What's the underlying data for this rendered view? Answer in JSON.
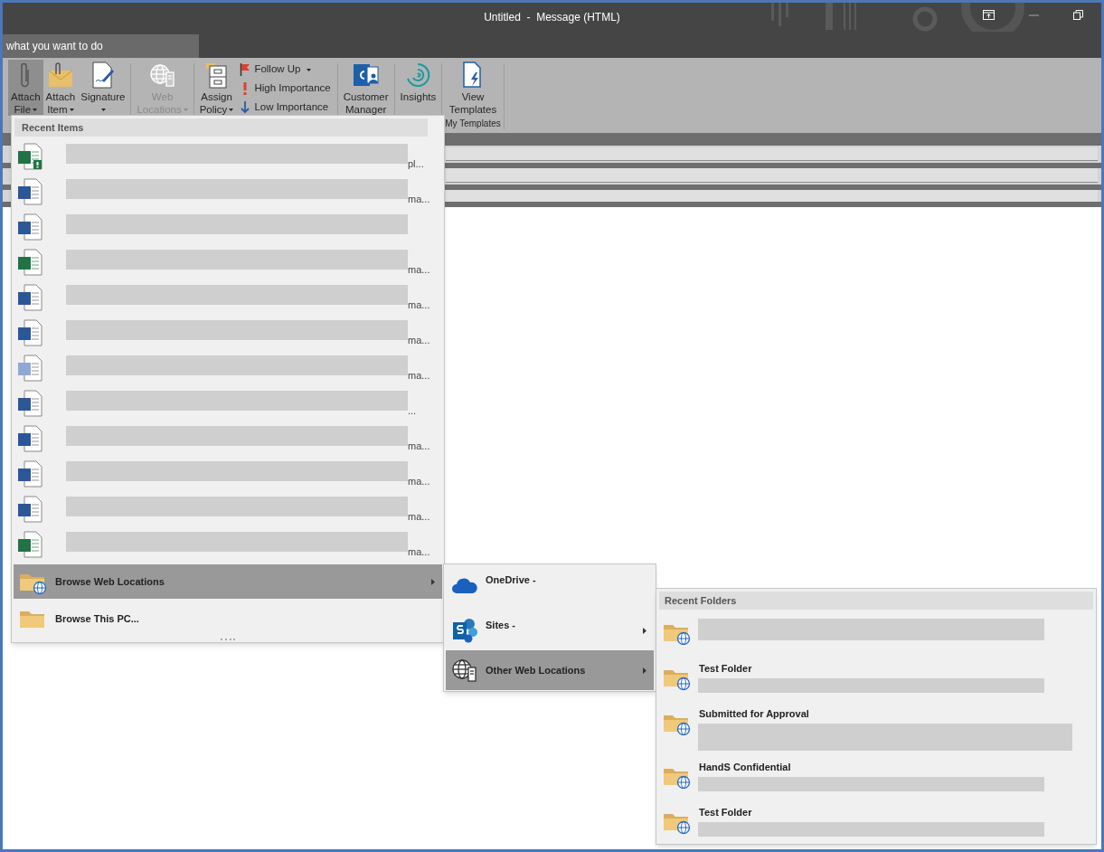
{
  "window": {
    "title": "Untitled  -  Message (HTML)"
  },
  "tell_me": {
    "text": "what you want to do"
  },
  "ribbon": [
    {
      "kind": "paperclip",
      "line1": "Attach",
      "line2": "File",
      "dropdown": true,
      "selected": true,
      "disabled": false
    },
    {
      "kind": "envelope-clip",
      "line1": "Attach",
      "line2": "Item",
      "dropdown": true,
      "selected": false,
      "disabled": false
    },
    {
      "kind": "signature",
      "line1": "Signature",
      "dropdown": true,
      "selected": false,
      "disabled": false
    },
    {
      "kind": "separator"
    },
    {
      "kind": "globe-server",
      "line1": "Web",
      "line2": "Locations",
      "dropdown": true,
      "selected": false,
      "disabled": true
    },
    {
      "kind": "separator"
    },
    {
      "kind": "cabinet",
      "line1": "Assign",
      "line2": "Policy",
      "dropdown": true,
      "selected": false,
      "disabled": false
    },
    {
      "kind": "stack",
      "items": [
        {
          "kind": "flag",
          "label": "Follow Up",
          "dropdown": true
        },
        {
          "kind": "exclamation",
          "label": "High Importance",
          "dropdown": false
        },
        {
          "kind": "down-arrow",
          "label": "Low Importance",
          "dropdown": false
        }
      ]
    },
    {
      "kind": "separator"
    },
    {
      "kind": "contact-card",
      "line1": "Customer",
      "line2": "Manager",
      "dropdown": false,
      "selected": false,
      "disabled": false
    },
    {
      "kind": "separator"
    },
    {
      "kind": "insights",
      "line1": "Insights",
      "dropdown": false,
      "selected": false,
      "disabled": false
    },
    {
      "kind": "separator"
    },
    {
      "kind": "template",
      "line1": "View",
      "line2": "Templates",
      "dropdown": false,
      "selected": false,
      "disabled": false,
      "group": "My Templates"
    },
    {
      "kind": "separator"
    }
  ],
  "attach_menu": {
    "header": "Recent Items",
    "items": [
      {
        "kind": "excel-warning",
        "path_end": "pl..."
      },
      {
        "kind": "word",
        "path_end": "ma..."
      },
      {
        "kind": "word"
      },
      {
        "kind": "excel",
        "path_end": "ma..."
      },
      {
        "kind": "word",
        "path_end": "ma..."
      },
      {
        "kind": "word",
        "path_end": "ma..."
      },
      {
        "kind": "word-template",
        "path_end": "ma..."
      },
      {
        "kind": "word",
        "path_end": "..."
      },
      {
        "kind": "word",
        "path_end": "ma..."
      },
      {
        "kind": "word",
        "path_end": "ma..."
      },
      {
        "kind": "word",
        "path_end": "ma..."
      },
      {
        "kind": "excel",
        "path_end": "ma..."
      }
    ],
    "actions": [
      {
        "kind": "web-folder",
        "label": "Browse Web Locations",
        "selected": true,
        "submenu": true
      },
      {
        "kind": "folder",
        "label": "Browse This PC...",
        "selected": false,
        "submenu": false
      }
    ]
  },
  "web_menu": {
    "items": [
      {
        "kind": "onedrive",
        "label": "OneDrive -",
        "selected": false,
        "submenu": false
      },
      {
        "kind": "sharepoint",
        "label": "Sites -",
        "selected": false,
        "submenu": true
      },
      {
        "kind": "globe-server",
        "label": "Other Web Locations",
        "selected": true,
        "submenu": true
      }
    ]
  },
  "folders_menu": {
    "header": "Recent Folders",
    "items": [
      {
        "kind": "hidden-title"
      },
      {
        "title": "Test Folder",
        "kind": "short-path"
      },
      {
        "title": "Submitted for Approval",
        "kind": "long-path"
      },
      {
        "title": "HandS Confidential",
        "kind": "short-path"
      },
      {
        "title": "Test Folder",
        "kind": "short-path"
      }
    ]
  }
}
